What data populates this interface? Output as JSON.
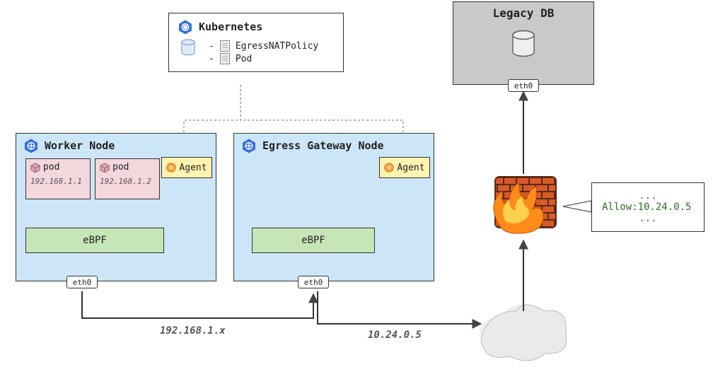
{
  "control_plane": {
    "title": "Kubernetes",
    "resources": [
      "EgressNATPolicy",
      "Pod"
    ]
  },
  "worker_node": {
    "title": "Worker Node",
    "pods": [
      {
        "label": "pod",
        "ip": "192.168.1.1"
      },
      {
        "label": "pod",
        "ip": "192.168.1.2"
      }
    ],
    "agent_label": "Agent",
    "datapath_label": "eBPF",
    "interface": "eth0"
  },
  "egress_node": {
    "title": "Egress Gateway Node",
    "agent_label": "Agent",
    "datapath_label": "eBPF",
    "interface": "eth0"
  },
  "legacy": {
    "title": "Legacy DB",
    "interface": "eth0"
  },
  "firewall": {
    "rule_prefix": "...",
    "rule_text": "Allow:10.24.0.5",
    "rule_suffix": "..."
  },
  "paths": {
    "worker_to_gw": "192.168.1.x",
    "gw_to_cloud": "10.24.0.5"
  }
}
